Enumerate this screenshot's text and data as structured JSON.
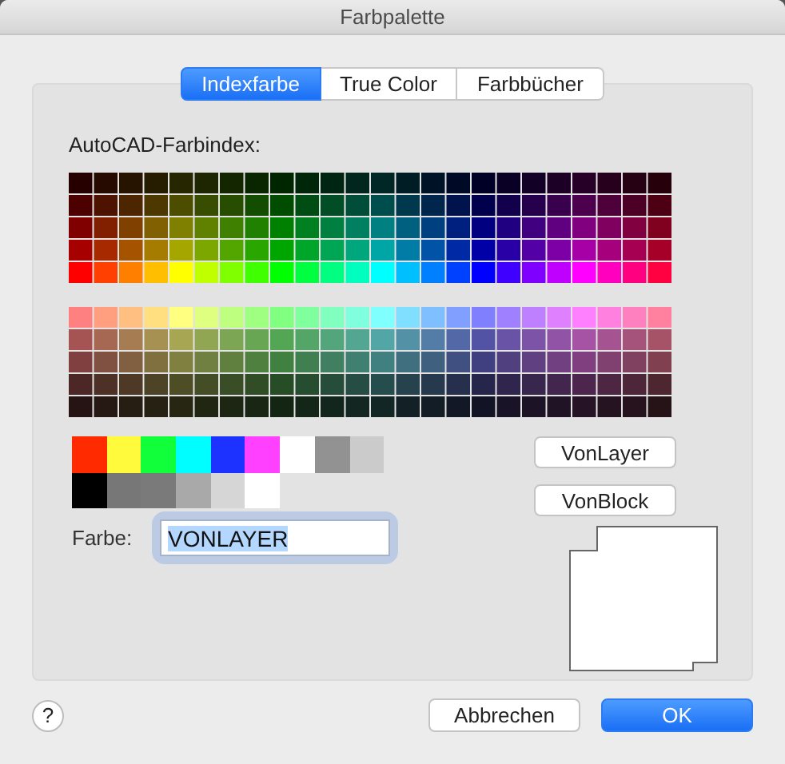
{
  "window": {
    "title": "Farbpalette"
  },
  "tabs": [
    {
      "label": "Indexfarbe",
      "selected": true
    },
    {
      "label": "True Color",
      "selected": false
    },
    {
      "label": "Farbbücher",
      "selected": false
    }
  ],
  "palette_label": "AutoCAD-Farbindex:",
  "standard_colors": [
    {
      "color": "#ff2a00"
    },
    {
      "color": "#fffa3c"
    },
    {
      "color": "#11ff3a"
    },
    {
      "color": "#00fdff"
    },
    {
      "color": "#1e32ff"
    },
    {
      "color": "#ff40ff"
    },
    {
      "color": "#ffffff"
    },
    {
      "color": "#929292"
    },
    {
      "color": "#cbcbcb"
    }
  ],
  "gray_colors": [
    {
      "color": "#000000"
    },
    {
      "color": "#777777"
    },
    {
      "color": "#7a7a7a"
    },
    {
      "color": "#a9a9a9"
    },
    {
      "color": "#d6d6d6"
    },
    {
      "color": "#ffffff"
    }
  ],
  "side_buttons": [
    "VonLayer",
    "VonBlock"
  ],
  "color_field": {
    "label": "Farbe:",
    "value": "VONLAYER",
    "focused": true
  },
  "help_button": "?",
  "footer_buttons": [
    {
      "label": "Abbrechen",
      "default": false
    },
    {
      "label": "OK",
      "default": true
    }
  ]
}
